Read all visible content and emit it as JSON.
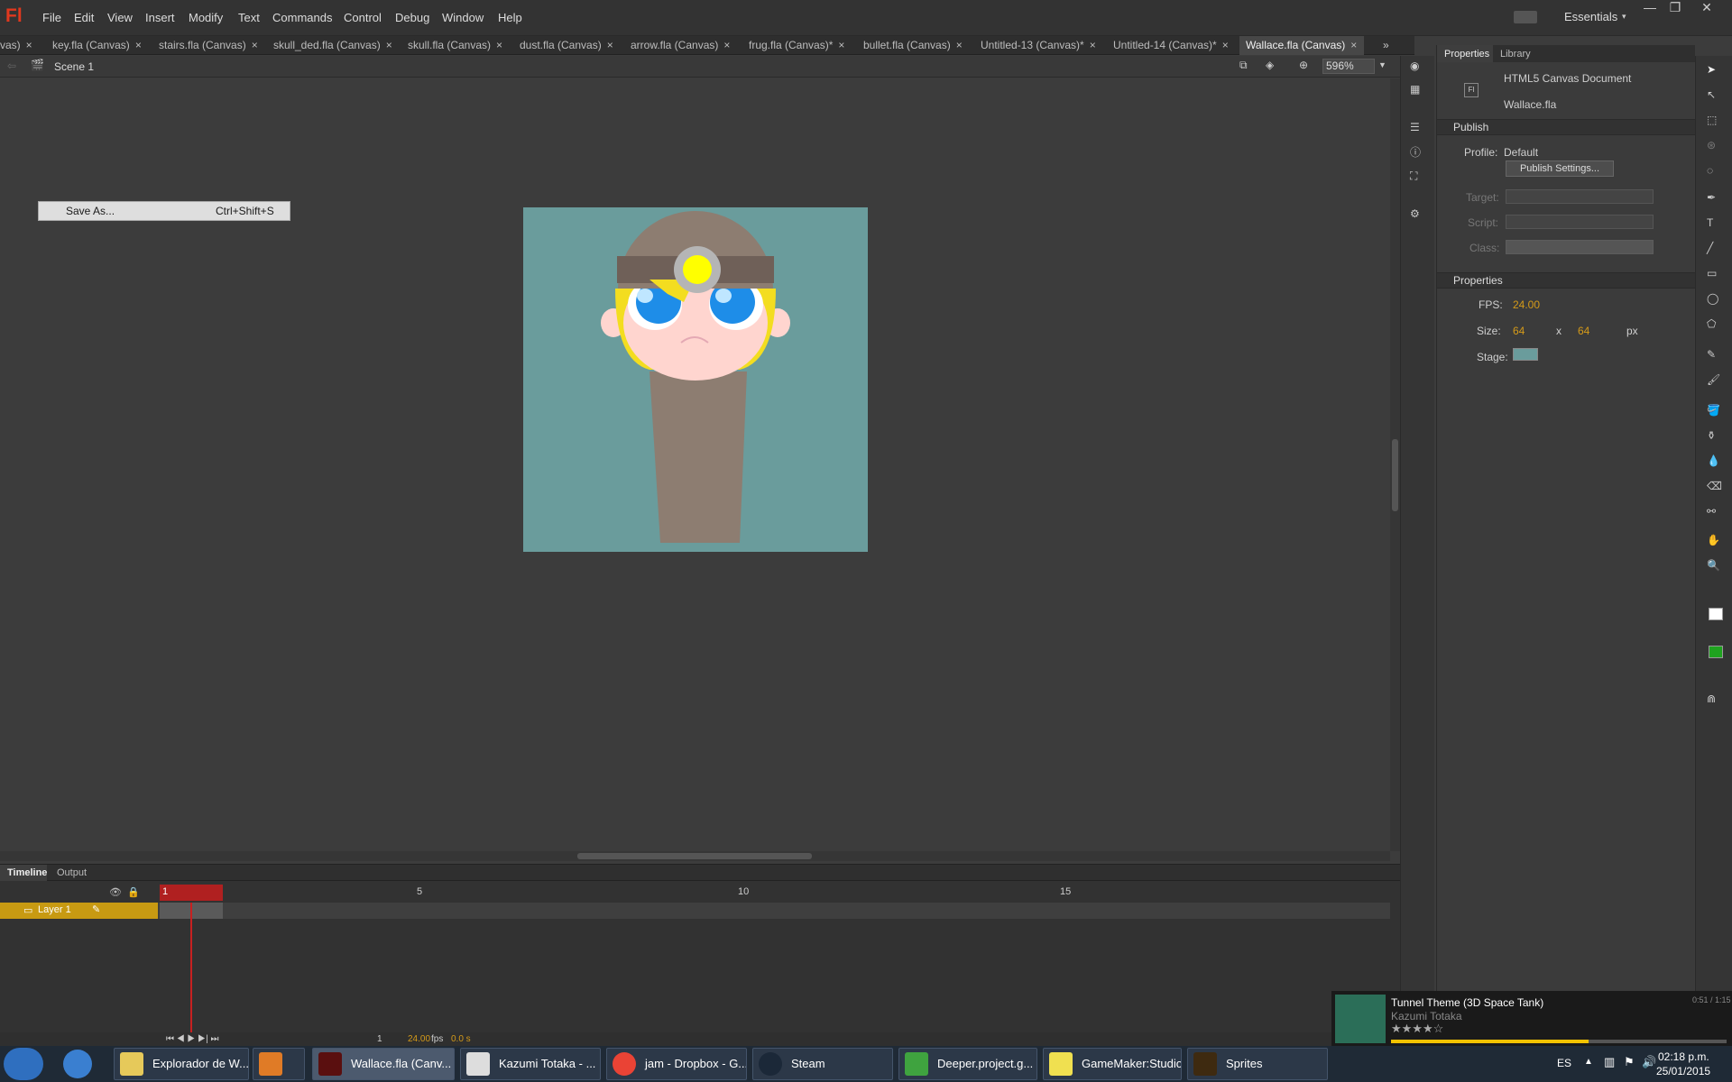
{
  "menubar": {
    "logo": "Fl",
    "items": [
      "File",
      "Edit",
      "View",
      "Insert",
      "Modify",
      "Text",
      "Commands",
      "Control",
      "Debug",
      "Window",
      "Help"
    ],
    "workspace": "Essentials"
  },
  "doc_tabs": [
    {
      "label": "vas)"
    },
    {
      "label": "key.fla (Canvas)"
    },
    {
      "label": "stairs.fla (Canvas)"
    },
    {
      "label": "skull_ded.fla (Canvas)"
    },
    {
      "label": "skull.fla (Canvas)"
    },
    {
      "label": "dust.fla (Canvas)"
    },
    {
      "label": "arrow.fla (Canvas)"
    },
    {
      "label": "frug.fla (Canvas)*"
    },
    {
      "label": "bullet.fla (Canvas)"
    },
    {
      "label": "Untitled-13 (Canvas)*"
    },
    {
      "label": "Untitled-14 (Canvas)*"
    },
    {
      "label": "Wallace.fla (Canvas)"
    }
  ],
  "editbar": {
    "scene": "Scene 1",
    "zoom": "596%"
  },
  "context_menu": {
    "label": "Save As...",
    "shortcut": "Ctrl+Shift+S"
  },
  "stage": {
    "color": "#6a9c9c"
  },
  "timeline": {
    "tabs": [
      "Timeline",
      "Output"
    ],
    "frame_numbers": [
      "1",
      "5",
      "10",
      "15"
    ],
    "layer_name": "Layer 1",
    "footer": {
      "frame": "1",
      "fps": "24.00",
      "fps_unit": "fps",
      "time": "0.0 s"
    }
  },
  "properties": {
    "tabs": [
      "Properties",
      "Library"
    ],
    "doc_type": "HTML5 Canvas Document",
    "doc_name": "Wallace.fla",
    "publish_title": "Publish",
    "profile_label": "Profile:",
    "profile_value": "Default",
    "publish_settings_btn": "Publish Settings...",
    "target_label": "Target:",
    "script_label": "Script:",
    "class_label": "Class:",
    "properties_title": "Properties",
    "fps_label": "FPS:",
    "fps_value": "24.00",
    "size_label": "Size:",
    "width": "64",
    "x": "x",
    "height": "64",
    "unit": "px",
    "stage_label": "Stage:"
  },
  "nowplaying": {
    "title": "Tunnel Theme (3D Space Tank)",
    "artist": "Kazumi Totaka",
    "time": "0:51 / 1:15"
  },
  "taskbar": {
    "items": [
      {
        "label": "Explorador de W..."
      },
      {
        "label": ""
      },
      {
        "label": "Wallace.fla (Canv..."
      },
      {
        "label": "Kazumi Totaka - ..."
      },
      {
        "label": "jam - Dropbox - G..."
      },
      {
        "label": "Steam"
      },
      {
        "label": "Deeper.project.g..."
      },
      {
        "label": "GameMaker:Studio"
      },
      {
        "label": "Sprites"
      }
    ],
    "lang": "ES",
    "time": "02:18 p.m.",
    "date": "25/01/2015"
  }
}
